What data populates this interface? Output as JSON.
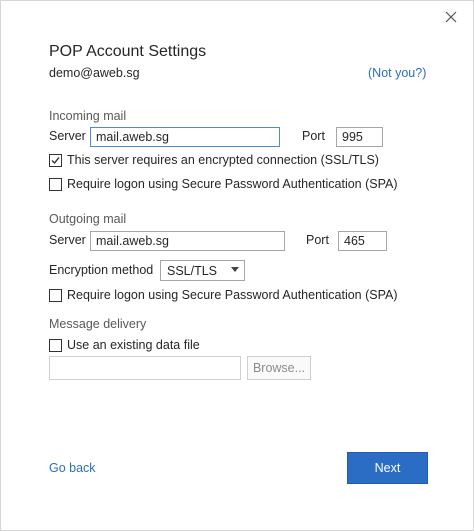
{
  "dialog": {
    "title": "POP Account Settings",
    "account_email": "demo@aweb.sg",
    "not_you_link": "(Not you?)"
  },
  "incoming": {
    "section_label": "Incoming mail",
    "server_label": "Server",
    "server_value": "mail.aweb.sg",
    "port_label": "Port",
    "port_value": "995",
    "ssl_checkbox_label": "This server requires an encrypted connection (SSL/TLS)",
    "ssl_checked": true,
    "spa_checkbox_label": "Require logon using Secure Password Authentication (SPA)",
    "spa_checked": false
  },
  "outgoing": {
    "section_label": "Outgoing mail",
    "server_label": "Server",
    "server_value": "mail.aweb.sg",
    "port_label": "Port",
    "port_value": "465",
    "encryption_label": "Encryption method",
    "encryption_value": "SSL/TLS",
    "spa_checkbox_label": "Require logon using Secure Password Authentication (SPA)",
    "spa_checked": false
  },
  "delivery": {
    "section_label": "Message delivery",
    "existing_file_label": "Use an existing data file",
    "existing_file_checked": false,
    "file_path_value": "",
    "browse_label": "Browse..."
  },
  "footer": {
    "go_back_label": "Go back",
    "next_label": "Next"
  },
  "colors": {
    "accent": "#2b6cc4",
    "link": "#2b6fc0",
    "focus_border": "#4b8bd4"
  },
  "icons": {
    "close": "close-icon",
    "checkmark": "checkmark-icon",
    "dropdown": "chevron-down-icon"
  }
}
